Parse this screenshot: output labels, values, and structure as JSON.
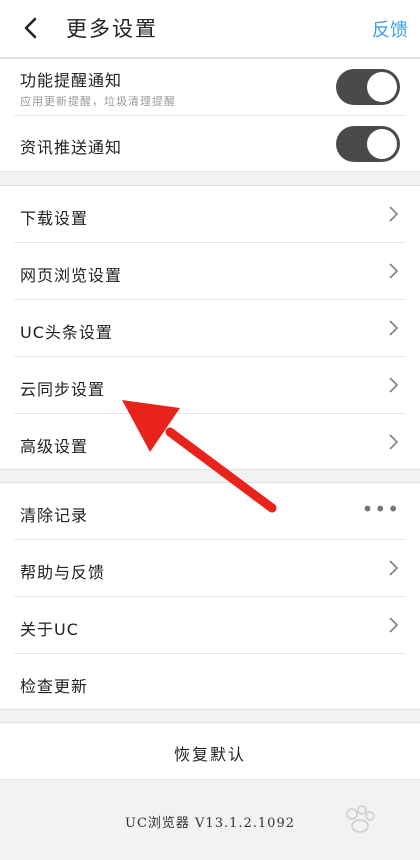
{
  "header": {
    "back_icon": "chevron-left-icon",
    "title": "更多设置",
    "feedback_label": "反馈"
  },
  "notifications": {
    "items": [
      {
        "label": "功能提醒通知",
        "sub": "应用更新提醒，垃圾清理提醒",
        "enabled": true
      },
      {
        "label": "资讯推送通知",
        "enabled": true
      }
    ]
  },
  "settings": {
    "items": [
      {
        "label": "下载设置"
      },
      {
        "label": "网页浏览设置"
      },
      {
        "label": "UC头条设置"
      },
      {
        "label": "云同步设置"
      },
      {
        "label": "高级设置"
      }
    ]
  },
  "misc": {
    "items": [
      {
        "label": "清除记录",
        "accessory": "more-dots-icon"
      },
      {
        "label": "帮助与反馈"
      },
      {
        "label": "关于UC"
      },
      {
        "label": "检查更新"
      }
    ]
  },
  "reset_label": "恢复默认",
  "version_text": "UC浏览器 V13.1.2.1092",
  "colors": {
    "accent": "#3b9ee8",
    "toggle_on": "#4a4a4a",
    "annotation_arrow": "#e8231c"
  }
}
